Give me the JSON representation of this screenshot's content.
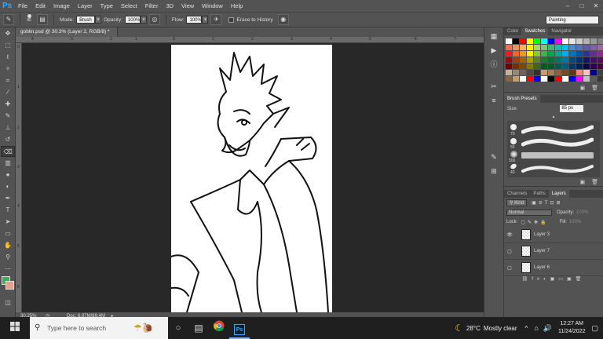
{
  "menubar": {
    "logo": "Ps",
    "items": [
      "File",
      "Edit",
      "Image",
      "Layer",
      "Type",
      "Select",
      "Filter",
      "3D",
      "View",
      "Window",
      "Help"
    ],
    "controls": {
      "minimize": "–",
      "maximize": "□",
      "close": "✕"
    }
  },
  "options": {
    "brush_size": "85",
    "mode_label": "Mode:",
    "mode_value": "Brush",
    "opacity_label": "Opacity:",
    "opacity_value": "100%",
    "flow_label": "Flow:",
    "flow_value": "100%",
    "erase_history_label": "Erase to History",
    "workspace": "Painting"
  },
  "document": {
    "tab_title": "goblin.psd @ 30.3% (Layer 2, RGB/8) *",
    "zoom": "30.25%",
    "doc_info": "Doc: 6.87M/69.4M"
  },
  "ruler": {
    "top": [
      "4",
      "3",
      "2",
      "1",
      "0",
      "1",
      "2",
      "3",
      "4",
      "5",
      "6",
      "7"
    ],
    "left": [
      "0",
      "1",
      "2",
      "3",
      "4",
      "5",
      "6"
    ]
  },
  "swatches_panel": {
    "tabs": [
      "Color",
      "Swatches",
      "Navigator"
    ],
    "active_tab": "Swatches",
    "colors": [
      "#ffffff",
      "#000000",
      "#ff0000",
      "#ffff00",
      "#00ff00",
      "#00ffff",
      "#0000ff",
      "#ff00ff",
      "#ffffff",
      "#e6e6e6",
      "#cccccc",
      "#b3b3b3",
      "#999999",
      "#808080",
      "#f26c4f",
      "#f68e56",
      "#fbaf5d",
      "#fff200",
      "#acd372",
      "#7cc576",
      "#3bb878",
      "#1abbb4",
      "#00bff3",
      "#438ccb",
      "#5674b9",
      "#605ca8",
      "#855fa8",
      "#a763a8",
      "#ed1c24",
      "#f26522",
      "#f7941d",
      "#fff200",
      "#8dc73f",
      "#39b54a",
      "#00a651",
      "#00a99d",
      "#00aeef",
      "#0072bc",
      "#0054a6",
      "#2e3192",
      "#662d91",
      "#92278f",
      "#9e0b0f",
      "#a0410d",
      "#a3620a",
      "#aba000",
      "#598527",
      "#197b30",
      "#007236",
      "#00746b",
      "#0076a3",
      "#004a80",
      "#003471",
      "#1b1464",
      "#440e62",
      "#630460",
      "#790000",
      "#7b2e00",
      "#7d4900",
      "#827b00",
      "#406618",
      "#005e20",
      "#005826",
      "#005952",
      "#005b7f",
      "#003663",
      "#002157",
      "#0d004c",
      "#32004b",
      "#4b0049",
      "#c7b299",
      "#998675",
      "#736357",
      "#534741",
      "#37302a",
      "#c69c6d",
      "#a67c52",
      "#8c6239",
      "#754c24",
      "#603913",
      "#ff8080",
      "#ffc0c0",
      "#0000a0",
      "#404040",
      "#8c6239",
      "#c69c6d",
      "#ffffff",
      "#ff0000",
      "#0000ff",
      "#ffffff",
      "#000000",
      "#ff0000",
      "#ffffff",
      "#0000ff",
      "#ff00ff",
      "#c0c0c0",
      "#5c5c5c",
      "#3a3a3a"
    ],
    "footer_icons": [
      "new-icon",
      "trash-icon"
    ]
  },
  "brush_presets": {
    "title": "Brush Presets",
    "size_label": "Size:",
    "size_value": "85 px",
    "brushes": [
      {
        "size": "70"
      },
      {
        "size": "55"
      },
      {
        "size": "500"
      },
      {
        "size": "40"
      }
    ]
  },
  "layers_panel": {
    "tabs": [
      "Channels",
      "Paths",
      "Layers"
    ],
    "active_tab": "Layers",
    "filter_label": "Kind",
    "blend_mode": "Normal",
    "opacity_label": "Opacity:",
    "opacity_value": "100%",
    "lock_label": "Lock:",
    "fill_label": "Fill:",
    "fill_value": "100%",
    "layers": [
      {
        "name": "Layer 3",
        "visible": true
      },
      {
        "name": "Layer 7",
        "visible": false
      },
      {
        "name": "Layer 6",
        "visible": false
      }
    ]
  },
  "taskbar": {
    "search_placeholder": "Type here to search",
    "weather_temp": "28°C",
    "weather_desc": "Mostly clear",
    "time": "12:27 AM",
    "date": "11/24/2022",
    "up_arrow": "^",
    "notify": "▢",
    "ps_label": "Ps"
  }
}
